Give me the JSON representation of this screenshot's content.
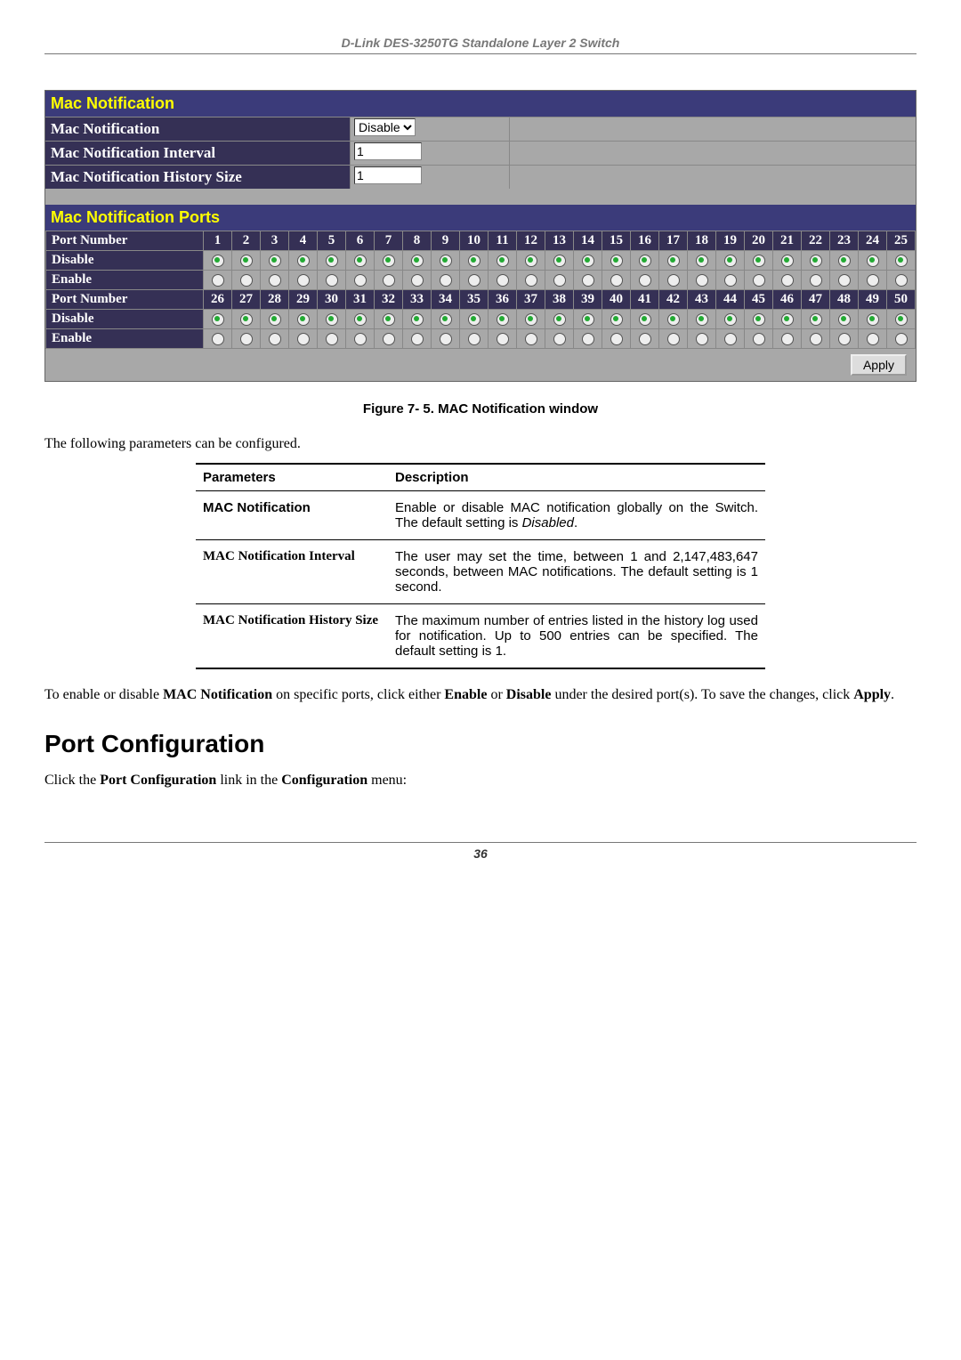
{
  "header": "D-Link DES-3250TG Standalone Layer 2 Switch",
  "panel": {
    "title1": "Mac Notification",
    "row_labels": {
      "notif": "Mac Notification",
      "interval": "Mac Notification Interval",
      "hist": "Mac Notification History Size"
    },
    "notif_value": "Disable",
    "interval_value": "1",
    "hist_value": "1",
    "title2": "Mac Notification Ports",
    "port_label": "Port Number",
    "disable_label": "Disable",
    "enable_label": "Enable",
    "ports_row1": [
      "1",
      "2",
      "3",
      "4",
      "5",
      "6",
      "7",
      "8",
      "9",
      "10",
      "11",
      "12",
      "13",
      "14",
      "15",
      "16",
      "17",
      "18",
      "19",
      "20",
      "21",
      "22",
      "23",
      "24",
      "25"
    ],
    "ports_row2": [
      "26",
      "27",
      "28",
      "29",
      "30",
      "31",
      "32",
      "33",
      "34",
      "35",
      "36",
      "37",
      "38",
      "39",
      "40",
      "41",
      "42",
      "43",
      "44",
      "45",
      "46",
      "47",
      "48",
      "49",
      "50"
    ],
    "apply_label": "Apply"
  },
  "figure_caption": "Figure 7- 5. MAC Notification window",
  "intro_1": "The following parameters can be configured.",
  "param_table": {
    "head_param": "Parameters",
    "head_desc": "Description",
    "rows": [
      {
        "name": "MAC Notification",
        "name_style": "arial",
        "desc_html": "Enable or disable MAC notification globally on the Switch. The default setting is <span class='ital'>Disabled</span>."
      },
      {
        "name": "MAC Notification Interval",
        "name_style": "times",
        "desc_html": "The user may set the time, between 1 and 2,147,483,647 seconds, between MAC notifications. The default setting is 1 second."
      },
      {
        "name": "MAC Notification History Size",
        "name_style": "times",
        "desc_html": "The maximum number of entries listed in the history log used for notification. Up to 500 entries can be specified. The default setting is 1."
      }
    ]
  },
  "body_2_html": "To enable or disable <span class='bold'>MAC Notification</span> on specific ports, click either <span class='bold'>Enable</span> or <span class='bold'>Disable</span> under the desired port(s).  To save the changes, click <span class='bold'>Apply</span>.",
  "section_heading": "Port Configuration",
  "body_3_html": "Click the <span class='bold'>Port Configuration</span> link in the <span class='bold'>Configuration</span> menu:",
  "page_number": "36"
}
